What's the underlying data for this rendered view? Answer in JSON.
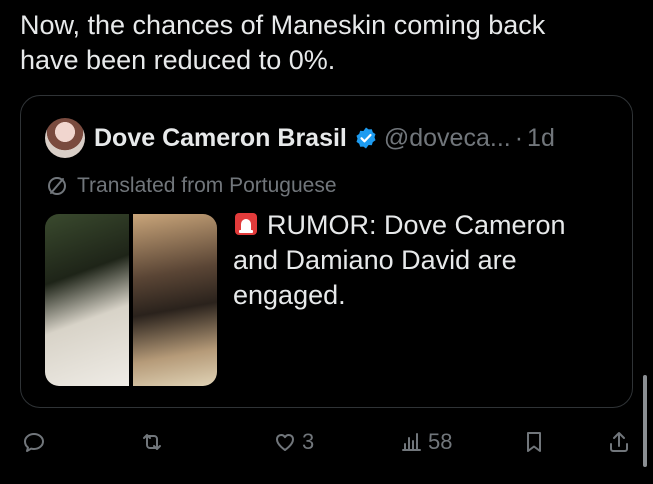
{
  "tweet": {
    "text": "Now, the chances of Maneskin coming back\nhave been reduced to 0%."
  },
  "quote": {
    "author_name": "Dove Cameron Brasil",
    "handle": "@doveca...",
    "separator": "·",
    "time": "1d",
    "translated_label": "Translated from Portuguese",
    "text": "RUMOR: Dove Cameron and Damiano David are engaged."
  },
  "actions": {
    "reply_count": "",
    "retweet_count": "",
    "like_count": "3",
    "views_count": "58"
  },
  "colors": {
    "background": "#000000",
    "text": "#e7e9ea",
    "muted": "#71767b",
    "border": "#2f3336",
    "verified": "#1d9bf0"
  }
}
